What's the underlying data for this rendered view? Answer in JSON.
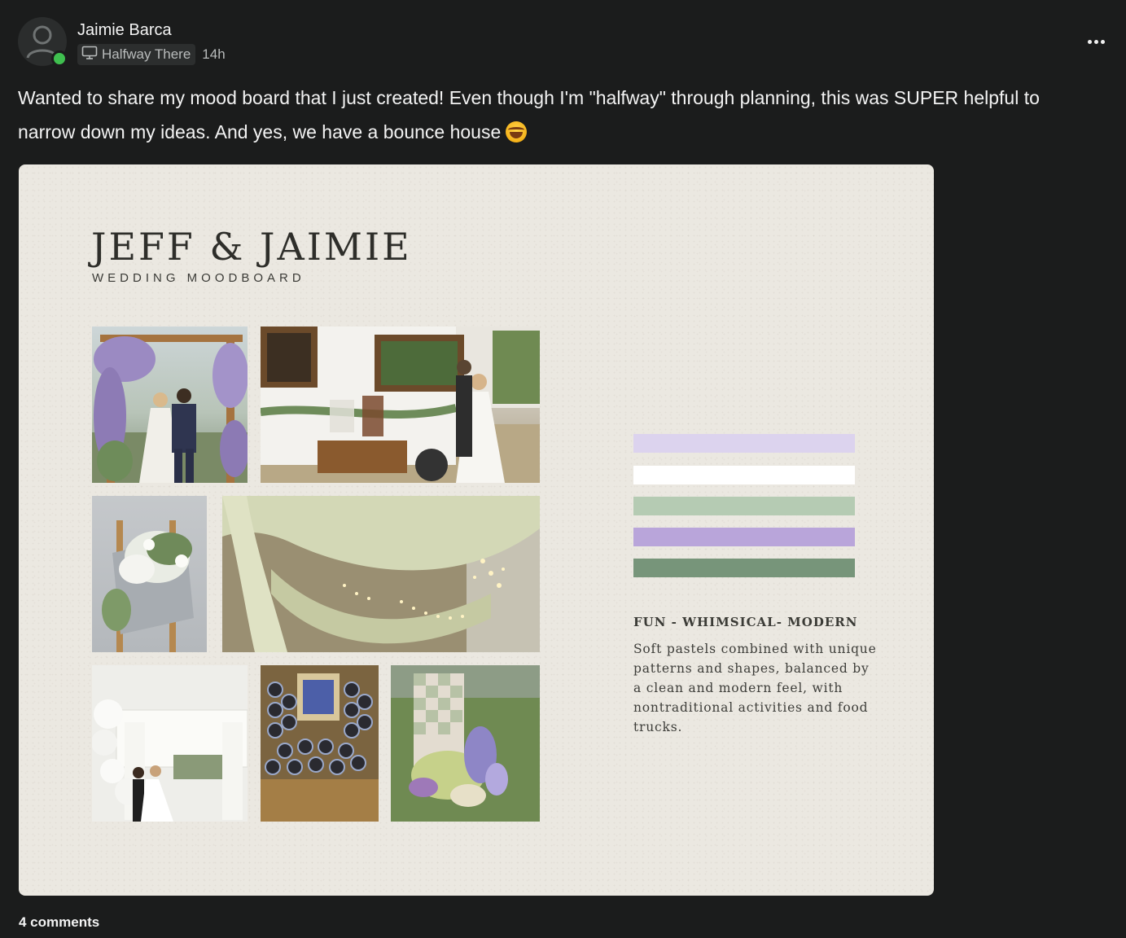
{
  "post": {
    "author": "Jaimie Barca",
    "group": "Halfway There",
    "time": "14h",
    "text": "Wanted to share my mood board that I just created! Even though I'm \"halfway\" through planning, this was SUPER helpful to narrow down my ideas. And yes, we have a bounce house",
    "emoji": "rolling-on-floor-laughing",
    "comments_label": "4 comments"
  },
  "moodboard": {
    "title": "JEFF & JAIMIE",
    "subtitle": "WEDDING MOODBOARD",
    "tagline": "FUN - WHIMSICAL- MODERN",
    "description": "Soft pastels combined with unique patterns and shapes, balanced by a clean and modern feel, with nontraditional activities and food trucks.",
    "palette": [
      "#dcd3ee",
      "#ffffff",
      "#b5cbb3",
      "#b9a5da",
      "#77957a"
    ],
    "photos": [
      "floral-arch-couple-photo",
      "vintage-bar-truck-photo",
      "floral-welcome-sign-photo",
      "draped-fabric-lights-photo",
      "bounce-house-couple-photo",
      "seating-chart-wall-photo",
      "checkered-floral-pillar-photo"
    ]
  },
  "icons": {
    "avatar": "user-avatar-icon",
    "group": "monitor-icon",
    "more": "more-options-icon"
  },
  "colors": {
    "background": "#1b1c1c",
    "online": "#3fbf4f",
    "board": "#ebe8e1"
  }
}
